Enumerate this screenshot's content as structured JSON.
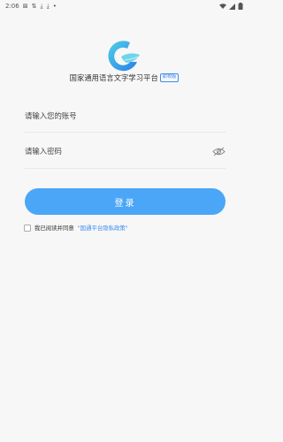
{
  "status_bar": {
    "time": "2:06",
    "notification_icons": [
      "photo-icon",
      "sync-icon",
      "download-icon",
      "download-icon",
      "dot-icon"
    ],
    "system_icons": [
      "wifi-icon",
      "signal-icon",
      "battery-icon"
    ]
  },
  "app": {
    "title": "国家通用语言文字学习平台",
    "badge": "职校版"
  },
  "form": {
    "username_placeholder": "请输入您的账号",
    "username_value": "",
    "password_placeholder": "请输入密码",
    "password_value": "",
    "login_label": "登录"
  },
  "agreement": {
    "text": "我已阅读并同意",
    "link": "\"国通平台隐私政策\"",
    "checked": false
  },
  "colors": {
    "accent": "#4ba6f7",
    "link": "#3d8bf0",
    "background": "#f7f7f7"
  }
}
